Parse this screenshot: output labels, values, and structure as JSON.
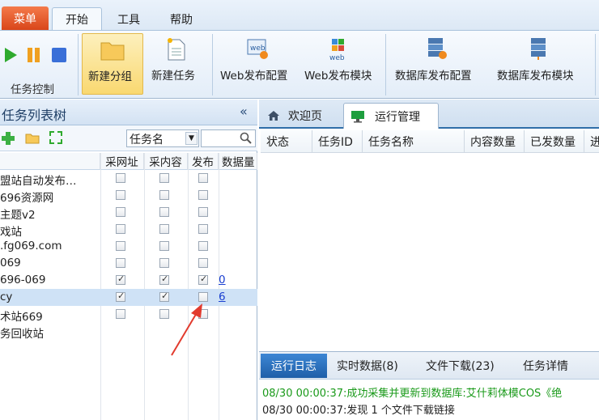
{
  "menubar": {
    "menu": "菜单",
    "tabs": [
      "开始",
      "工具",
      "帮助"
    ]
  },
  "ribbon": {
    "task_control_label": "任务控制",
    "buttons": {
      "new_group": "新建分组",
      "new_task": "新建任务",
      "web_publish_config": "Web发布配置",
      "web_publish_module": "Web发布模块",
      "db_publish_config": "数据库发布配置",
      "db_publish_module": "数据库发布模块"
    },
    "colors": {
      "play": "#2eaa2e",
      "pause": "#f0a020",
      "stop": "#3a6fd8",
      "highlight": "#fbe08a"
    }
  },
  "left_panel": {
    "title": "任务列表树",
    "collapse": "«",
    "filter_select": "任务名",
    "search_placeholder": "",
    "columns": [
      "采网址",
      "采内容",
      "发布",
      "数据量"
    ],
    "rows": [
      {
        "name": "盟站自动发布…",
        "c1": false,
        "c2": false,
        "c3": false,
        "count": ""
      },
      {
        "name": "696资源网",
        "c1": false,
        "c2": false,
        "c3": false,
        "count": ""
      },
      {
        "name": "主题v2",
        "c1": false,
        "c2": false,
        "c3": false,
        "count": ""
      },
      {
        "name": "戏站",
        "c1": false,
        "c2": false,
        "c3": false,
        "count": ""
      },
      {
        "name": ".fg069.com",
        "c1": false,
        "c2": false,
        "c3": false,
        "count": ""
      },
      {
        "name": "069",
        "c1": false,
        "c2": false,
        "c3": false,
        "count": ""
      },
      {
        "name": "696-069",
        "c1": true,
        "c2": true,
        "c3": true,
        "count": "0"
      },
      {
        "name": "cy",
        "c1": true,
        "c2": true,
        "c3": false,
        "count": "6"
      },
      {
        "name": "术站669",
        "c1": false,
        "c2": false,
        "c3": false,
        "count": ""
      },
      {
        "name": "务回收站",
        "c1": null,
        "c2": null,
        "c3": null,
        "count": ""
      }
    ]
  },
  "right_panel": {
    "tabs": [
      "欢迎页",
      "运行管理"
    ],
    "grid_columns": [
      "状态",
      "任务ID",
      "任务名称",
      "内容数量",
      "已发数量",
      "进"
    ]
  },
  "bottom_panel": {
    "tabs": [
      "运行日志",
      "实时数据(8)",
      "文件下载(23)",
      "任务详情"
    ],
    "logs": [
      {
        "text": "08/30 00:00:37:成功采集并更新到数据库:艾什莉体模COS《绝",
        "color": "#1a9a1a"
      },
      {
        "text": "08/30 00:00:37:发现 1 个文件下载链接",
        "color": "#222222"
      }
    ]
  }
}
